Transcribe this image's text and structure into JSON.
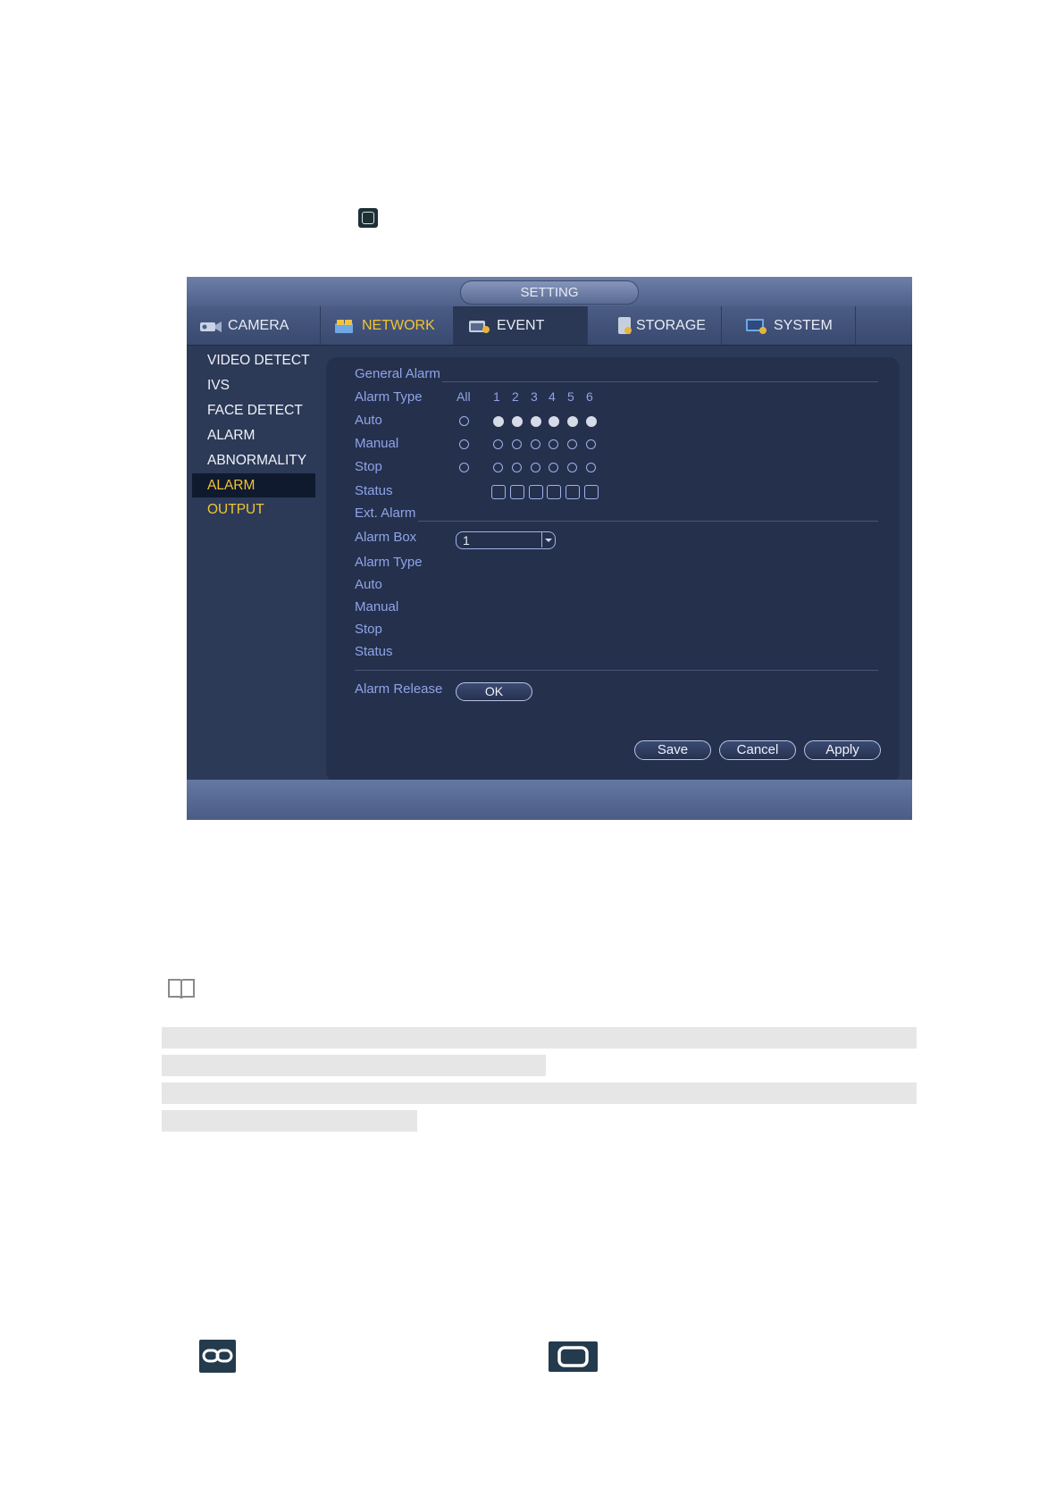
{
  "window": {
    "title": "SETTING",
    "tabs": [
      {
        "label": "CAMERA",
        "icon": "camera-icon"
      },
      {
        "label": "NETWORK",
        "icon": "network-icon"
      },
      {
        "label": "EVENT",
        "icon": "event-icon"
      },
      {
        "label": "STORAGE",
        "icon": "storage-icon"
      },
      {
        "label": "SYSTEM",
        "icon": "system-icon"
      }
    ],
    "active_tab": "EVENT",
    "sidebar": [
      "VIDEO DETECT",
      "IVS",
      "FACE DETECT",
      "ALARM",
      "ABNORMALITY",
      "ALARM OUTPUT"
    ],
    "active_sidebar": "ALARM OUTPUT"
  },
  "general_alarm": {
    "section_title": "General Alarm",
    "alarm_type_label": "Alarm Type",
    "all_label": "All",
    "channels": [
      "1",
      "2",
      "3",
      "4",
      "5",
      "6"
    ],
    "rows": [
      {
        "label": "Auto",
        "all": false,
        "channels": [
          true,
          true,
          true,
          true,
          true,
          true
        ]
      },
      {
        "label": "Manual",
        "all": false,
        "channels": [
          false,
          false,
          false,
          false,
          false,
          false
        ]
      },
      {
        "label": "Stop",
        "all": false,
        "channels": [
          false,
          false,
          false,
          false,
          false,
          false
        ]
      }
    ],
    "status_label": "Status"
  },
  "ext_alarm": {
    "section_title": "Ext. Alarm",
    "alarm_box_label": "Alarm Box",
    "alarm_box_value": "1",
    "labels": [
      "Alarm Type",
      "Auto",
      "Manual",
      "Stop",
      "Status"
    ]
  },
  "alarm_release": {
    "label": "Alarm Release",
    "button": "OK"
  },
  "buttons": {
    "save": "Save",
    "cancel": "Cancel",
    "apply": "Apply"
  },
  "colors": {
    "active_accent": "#f2c431",
    "label_blue": "#8fa4e8",
    "panel_bg": "#25304c"
  }
}
